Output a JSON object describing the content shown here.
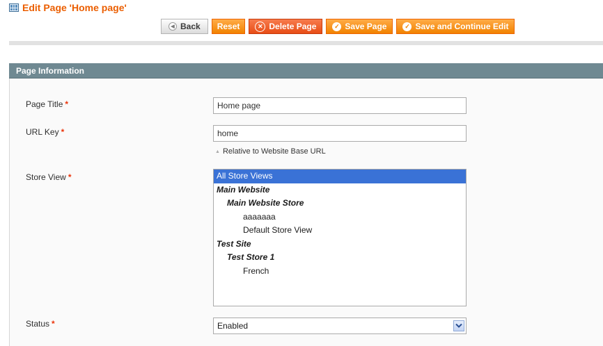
{
  "header": {
    "title": "Edit Page 'Home page'",
    "title_icon": "cms-page-icon"
  },
  "toolbar": {
    "back_label": "Back",
    "reset_label": "Reset",
    "delete_label": "Delete Page",
    "save_label": "Save Page",
    "save_continue_label": "Save and Continue Edit"
  },
  "section": {
    "title": "Page Information"
  },
  "form": {
    "page_title": {
      "label": "Page Title",
      "required": "*",
      "value": "Home page"
    },
    "url_key": {
      "label": "URL Key",
      "required": "*",
      "value": "home",
      "note": "Relative to Website Base URL"
    },
    "store_view": {
      "label": "Store View",
      "required": "*",
      "options": [
        {
          "label": "All Store Views",
          "level": "all",
          "selected": true
        },
        {
          "label": "Main Website",
          "level": "website",
          "selected": false
        },
        {
          "label": "Main Website Store",
          "level": "store",
          "selected": false
        },
        {
          "label": "aaaaaaa",
          "level": "view",
          "selected": false
        },
        {
          "label": "Default Store View",
          "level": "view",
          "selected": false
        },
        {
          "label": "Test Site",
          "level": "website",
          "selected": false
        },
        {
          "label": "Test Store 1",
          "level": "store",
          "selected": false
        },
        {
          "label": "French",
          "level": "view",
          "selected": false
        }
      ]
    },
    "status": {
      "label": "Status",
      "required": "*",
      "value": "Enabled"
    }
  },
  "colors": {
    "title": "#eb5e00",
    "button_orange": "#f18200",
    "section_header": "#6f8992",
    "selected_option": "#3a72d6",
    "required": "#eb340a"
  }
}
